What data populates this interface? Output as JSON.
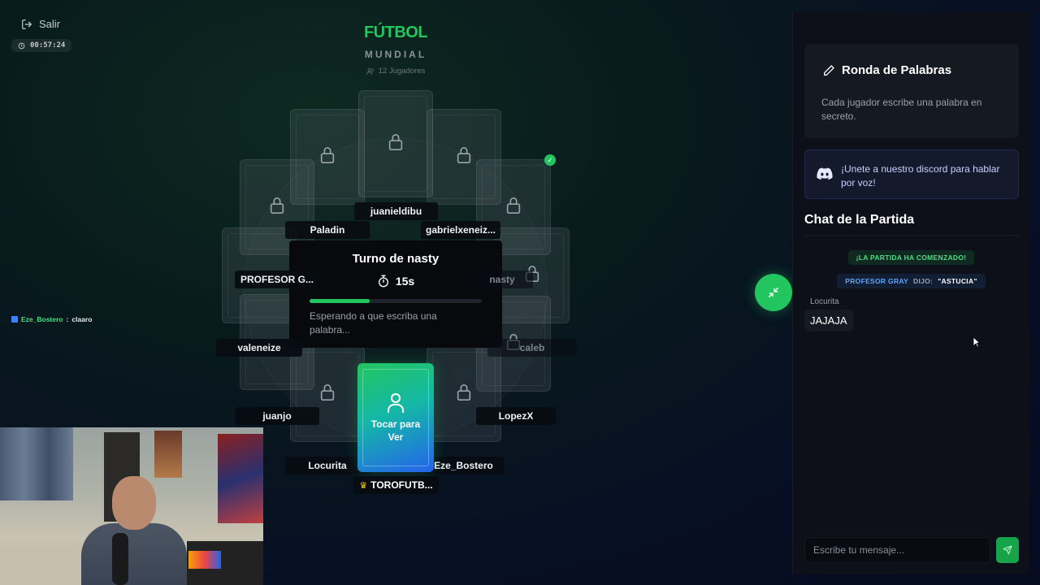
{
  "header": {
    "exit_label": "Salir",
    "elapsed_time": "00:57:24",
    "game_title": "FÚTBOL",
    "game_subtitle": "MUNDIAL",
    "players_count": "12 Jugadores"
  },
  "table": {
    "players": [
      {
        "name": "juanieldibu",
        "state": "locked"
      },
      {
        "name": "gabrielxeneiz...",
        "state": "locked"
      },
      {
        "name": "nasty",
        "state": "locked",
        "dim": true
      },
      {
        "name": "caleb",
        "state": "locked",
        "dim": true
      },
      {
        "name": "LopezX",
        "state": "locked"
      },
      {
        "name": "Eze_Bostero",
        "state": "locked"
      },
      {
        "name": "Locurita",
        "state": "locked"
      },
      {
        "name": "juanjo",
        "state": "locked"
      },
      {
        "name": "valeneize",
        "state": "locked"
      },
      {
        "name": "PROFESOR G...",
        "state": "locked"
      },
      {
        "name": "Paladin",
        "state": "locked"
      }
    ],
    "my_card": {
      "owner": "TOROFUTB...",
      "reveal_label": "Tocar para Ver"
    },
    "turn": {
      "title": "Turno de nasty",
      "time_left": "15s",
      "progress": 0.35,
      "status": "Esperando a que escriba una palabra..."
    }
  },
  "overlay_chat": {
    "user": "Eze_Bostero",
    "separator": ":",
    "message": "claaro"
  },
  "sidebar": {
    "round": {
      "title": "Ronda de Palabras",
      "description": "Cada jugador escribe una palabra en secreto."
    },
    "discord": {
      "text": "¡Unete a nuestro discord para hablar por voz!"
    },
    "chat": {
      "title": "Chat de la Partida",
      "system_message": "¡LA PARTIDA HA COMENZADO!",
      "said": {
        "name": "PROFESOR GRAY",
        "verb": "DIJO:",
        "word": "\"ASTUCIA\""
      },
      "messages": [
        {
          "author": "Locurita",
          "text": "JAJAJA"
        }
      ],
      "input_placeholder": "Escribe tu mensaje..."
    }
  },
  "colors": {
    "accent": "#22c55e",
    "discord": "#5865f2",
    "background": "#070f24"
  }
}
